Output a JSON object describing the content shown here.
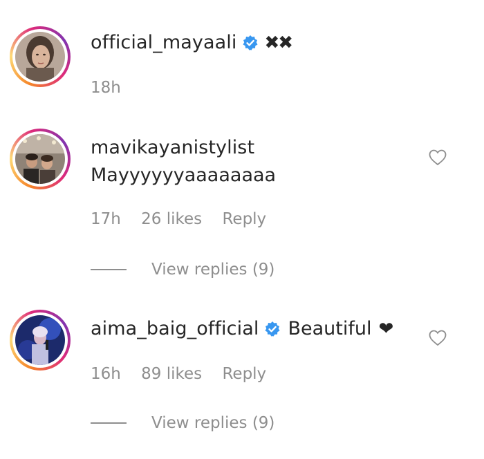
{
  "comments": [
    {
      "username": "official_mayaali",
      "verified": true,
      "inline_text": "✖✖",
      "time": "18h",
      "avatar": "woman-portrait-avatar"
    },
    {
      "username": "mavikayanistylist",
      "verified": false,
      "text": "Mayyyyyyaaaaaaaa",
      "time": "17h",
      "likes": "26 likes",
      "reply": "Reply",
      "view_replies": "View replies (9)",
      "avatar": "group-photo-avatar"
    },
    {
      "username": "aima_baig_official",
      "verified": true,
      "text": "Beautiful",
      "emoji": "❤",
      "time": "16h",
      "likes": "89 likes",
      "reply": "Reply",
      "view_replies": "View replies (9)",
      "avatar": "singer-photo-avatar"
    }
  ],
  "colors": {
    "verified_blue": "#3897f0",
    "meta_gray": "#8e8e8e",
    "text": "#262626"
  }
}
